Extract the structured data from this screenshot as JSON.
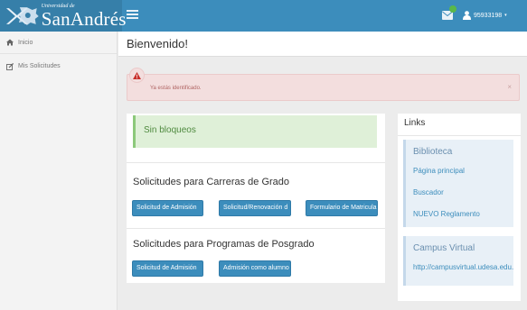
{
  "brand": {
    "small_text": "Universidad de",
    "name": "SanAndrés"
  },
  "navbar": {
    "user_id": "95933198",
    "caret": "▾"
  },
  "sidebar": {
    "items": [
      {
        "label": "Inicio"
      },
      {
        "label": "Mis Solicitudes"
      }
    ]
  },
  "header": {
    "title": "Bienvenido!"
  },
  "alert": {
    "message": "Ya estás identificado.",
    "close": "×"
  },
  "blocks": {
    "text": "Sin bloqueos"
  },
  "grado": {
    "title": "Solicitudes para Carreras de Grado",
    "buttons": [
      "Solicitud de Admisión",
      "Solicitud/Renovación d",
      "Formulario de Matricula"
    ]
  },
  "posgrado": {
    "title": "Solicitudes para Programas de Posgrado",
    "buttons": [
      "Solicitud de Admisión",
      "Admisión como alumno"
    ]
  },
  "links": {
    "title": "Links",
    "biblioteca": {
      "title": "Biblioteca",
      "items": [
        "Página principal",
        "Buscador",
        "NUEVO Reglamento"
      ]
    },
    "campus": {
      "title": "Campus Virtual",
      "items": [
        "http://campusvirtual.udesa.edu."
      ]
    }
  },
  "colors": {
    "navbar": "#3c8dbc",
    "brand_bg": "#367fa9",
    "alert_bg": "#f3dede",
    "success_bg": "#dff0d8",
    "button": "#3c8dbc",
    "link": "#3c8dbc"
  },
  "icons": {
    "crest": "crest-icon",
    "menu": "hamburger-icon",
    "mail": "envelope-icon",
    "user": "user-icon",
    "home": "home-icon",
    "requests": "edit-icon",
    "warning": "warning-icon"
  }
}
